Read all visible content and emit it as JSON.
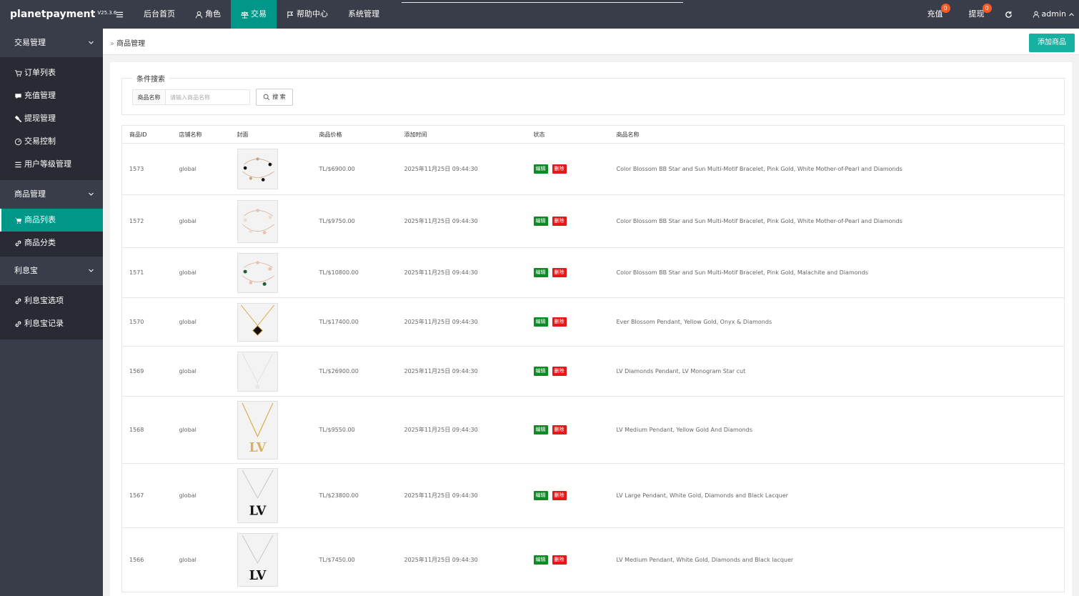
{
  "app": {
    "name": "planetpayment",
    "version": "V25.3.6"
  },
  "nav": [
    {
      "label": "后台首页",
      "icon": ""
    },
    {
      "label": "角色",
      "icon": "user-icon"
    },
    {
      "label": "交易",
      "icon": "scale-icon",
      "active": true
    },
    {
      "label": "帮助中心",
      "icon": "flag-icon"
    },
    {
      "label": "系统管理",
      "icon": ""
    }
  ],
  "topright": {
    "recharge": {
      "label": "充值",
      "count": "0"
    },
    "withdraw": {
      "label": "提现",
      "count": "0"
    },
    "user": "admin"
  },
  "sidebar": {
    "groups": [
      {
        "title": "交易管理",
        "items": [
          {
            "label": "订单列表",
            "icon": "cart-icon"
          },
          {
            "label": "充值管理",
            "icon": "message-icon"
          },
          {
            "label": "提现管理",
            "icon": "gavel-icon"
          },
          {
            "label": "交易控制",
            "icon": "dashboard-icon"
          },
          {
            "label": "用户等级管理",
            "icon": "list-icon"
          }
        ]
      },
      {
        "title": "商品管理",
        "items": [
          {
            "label": "商品列表",
            "icon": "cart-icon",
            "active": true
          },
          {
            "label": "商品分类",
            "icon": "link-icon"
          }
        ]
      },
      {
        "title": "利息宝",
        "items": [
          {
            "label": "利息宝选项",
            "icon": "link-icon"
          },
          {
            "label": "利息宝记录",
            "icon": "link-icon"
          }
        ]
      }
    ]
  },
  "breadcrumb": "商品管理",
  "add_button": "添加商品",
  "search": {
    "legend": "条件搜索",
    "label": "商品名称",
    "placeholder": "请输入商品名称",
    "button": "搜 索"
  },
  "table": {
    "headers": [
      "商品ID",
      "店铺名称",
      "封面",
      "商品价格",
      "添加时间",
      "状态",
      "商品名称"
    ],
    "edit_label": "编辑",
    "delete_label": "删除",
    "rows": [
      {
        "id": "1573",
        "shop": "global",
        "price": "TL/$6900.00",
        "time": "2025年11月25日 09:44:30",
        "name": "Color Blossom BB Star and Sun Multi-Motif Bracelet, Pink Gold, White Mother-of-Pearl and Diamonds",
        "cover": "bracelet-black"
      },
      {
        "id": "1572",
        "shop": "global",
        "price": "TL/$9750.00",
        "time": "2025年11月25日 09:44:30",
        "name": "Color Blossom BB Star and Sun Multi-Motif Bracelet, Pink Gold, White Mother-of-Pearl and Diamonds",
        "cover": "bracelet-pink"
      },
      {
        "id": "1571",
        "shop": "global",
        "price": "TL/$10800.00",
        "time": "2025年11月25日 09:44:30",
        "name": "Color Blossom BB Star and Sun Multi-Motif Bracelet, Pink Gold, Malachite and Diamonds",
        "cover": "bracelet-green"
      },
      {
        "id": "1570",
        "shop": "global",
        "price": "TL/$17400.00",
        "time": "2025年11月25日 09:44:30",
        "name": "Ever Blossom Pendant, Yellow Gold, Onyx & Diamonds",
        "cover": "pendant-onyx"
      },
      {
        "id": "1569",
        "shop": "global",
        "price": "TL/$26900.00",
        "time": "2025年11月25日 09:44:30",
        "name": "LV Diamonds Pendant, LV Monogram Star cut",
        "cover": "pendant-star"
      },
      {
        "id": "1568",
        "shop": "global",
        "price": "TL/$9550.00",
        "time": "2025年11月25日 09:44:30",
        "name": "LV Medium Pendant, Yellow Gold And Diamonds",
        "cover": "pendant-lv-gold"
      },
      {
        "id": "1567",
        "shop": "global",
        "price": "TL/$23800.00",
        "time": "2025年11月25日 09:44:30",
        "name": "LV Large Pendant, White Gold, Diamonds and Black Lacquer",
        "cover": "pendant-lv-black"
      },
      {
        "id": "1566",
        "shop": "global",
        "price": "TL/$7450.00",
        "time": "2025年11月25日 09:44:30",
        "name": "LV Medium Pendant, White Gold, Diamonds and Black lacquer",
        "cover": "pendant-lv-black"
      }
    ]
  },
  "colors": {
    "header": "#393d49",
    "sidebar_sub": "#282b33",
    "accent": "#009688",
    "edit": "#0d8b24",
    "delete": "#e01a1a",
    "badge": "#ff5722"
  }
}
